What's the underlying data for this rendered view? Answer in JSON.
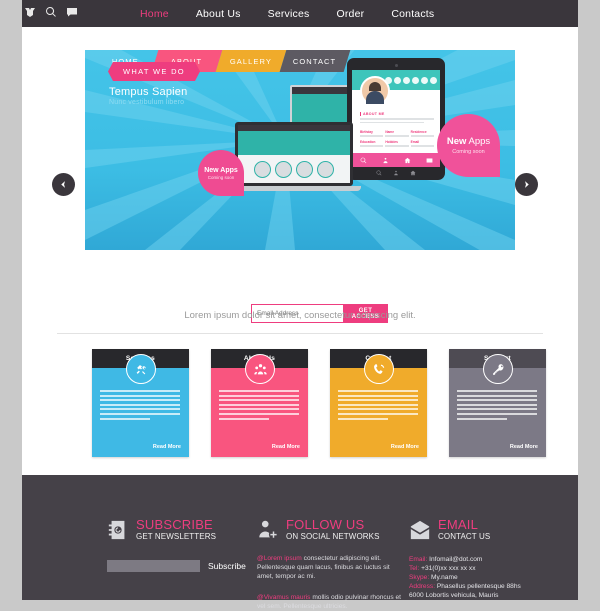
{
  "topbar": {
    "icons": [
      "bird-icon",
      "search-icon",
      "message-icon"
    ],
    "nav": [
      {
        "label": "Home",
        "active": true
      },
      {
        "label": "About Us",
        "active": false
      },
      {
        "label": "Services",
        "active": false
      },
      {
        "label": "Order",
        "active": false
      },
      {
        "label": "Contacts",
        "active": false
      }
    ]
  },
  "hero": {
    "tabs": [
      "HOME",
      "ABOUT",
      "GALLERY",
      "CONTACT"
    ],
    "badge": "WHAT WE DO",
    "heading": "Tempus Sapien",
    "subheading": "Nunc vestibulum libero",
    "new_apps_small": {
      "title_strong": "New",
      "title_rest": " Apps",
      "sub": "Coming soon"
    },
    "new_apps_large": {
      "title_strong": "New",
      "title_rest": " Apps",
      "sub": "Coming soon"
    },
    "tablet": {
      "about_title": "ABOUT ME",
      "fields": [
        "Birthday",
        "Name",
        "Residence",
        "Education",
        "Hobbies",
        "Email"
      ]
    },
    "prev_label": "‹",
    "next_label": "›"
  },
  "signup": {
    "placeholder": "Email Address",
    "button": "GET ACCESS"
  },
  "tagline": "Lorem ipsum dolor sit amet, consectetur adipiscing elit.",
  "cards": [
    {
      "title": "Services",
      "icon": "tools-icon",
      "more": "Read More",
      "color": "#3fb9e5"
    },
    {
      "title": "About Us",
      "icon": "people-icon",
      "more": "Read More",
      "color": "#f9557f"
    },
    {
      "title": "Contact",
      "icon": "phone-icon",
      "more": "Read More",
      "color": "#f0ab2b"
    },
    {
      "title": "Support",
      "icon": "key-icon",
      "more": "Read More",
      "color": "#7c7986"
    }
  ],
  "footer": {
    "subscribe": {
      "icon": "address-book-icon",
      "title": "SUBSCRIBE",
      "subtitle": "GET NEWSLETTERS",
      "input_value": "",
      "action_label": "Subscribe"
    },
    "follow": {
      "icon": "add-user-icon",
      "title": "FOLLOW US",
      "subtitle": "ON SOCIAL NETWORKS",
      "p1_handle": "@Lorem ipsum",
      "p1_text": " consectetur adipiscing elit. Pellentesque quam lacus, finibus ac luctus sit amet, tempor ac mi.",
      "p2_handle": "@Vivamus mauris",
      "p2_text": " mollis odio pulvinar rhoncus et vel sem. Pellentesque ultricies."
    },
    "email": {
      "icon": "envelope-icon",
      "title": "EMAIL",
      "subtitle": "CONTACT US",
      "rows": [
        {
          "key": "Email:",
          "val": " Infomail@dot.com"
        },
        {
          "key": "Tel:",
          "val": " +31(0)xx xxx xx xx"
        },
        {
          "key": "Skype:",
          "val": " My.name"
        },
        {
          "key": "Address:",
          "val": " Phasellus pellentesque 88hs"
        },
        {
          "key": "",
          "val": "6000 Lobortis vehicula, Mauris"
        }
      ]
    }
  },
  "colors": {
    "accent": "#ee3d7f",
    "dark": "#3a363c",
    "footer": "#454148",
    "hero": "#3cbde4"
  }
}
